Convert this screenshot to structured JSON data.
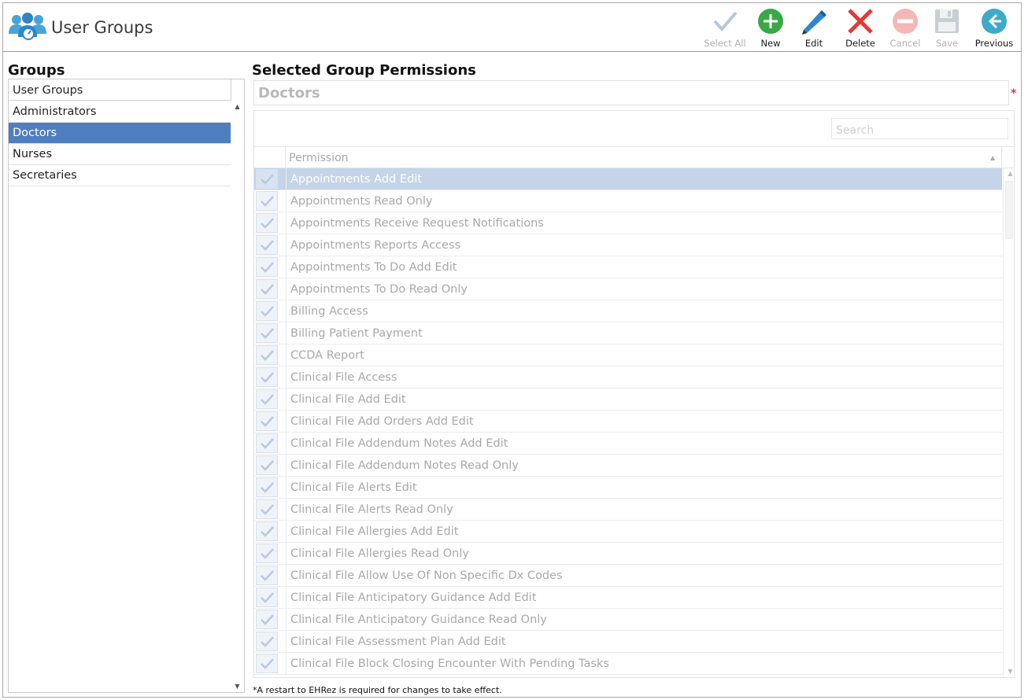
{
  "header": {
    "title": "User Groups",
    "icon": "user-groups-icon"
  },
  "toolbar": {
    "select_all": "Select All",
    "new": "New",
    "edit": "Edit",
    "delete": "Delete",
    "cancel": "Cancel",
    "save": "Save",
    "previous": "Previous"
  },
  "groups": {
    "title": "Groups",
    "column_header": "User Groups",
    "items": [
      {
        "label": "Administrators"
      },
      {
        "label": "Doctors"
      },
      {
        "label": "Nurses"
      },
      {
        "label": "Secretaries"
      }
    ],
    "selected": "Doctors"
  },
  "permissions": {
    "title": "Selected Group Permissions",
    "group_name": "Doctors",
    "required_mark": "*",
    "search_placeholder": "Search",
    "column_header": "Permission",
    "rows": [
      {
        "label": "Appointments Add Edit"
      },
      {
        "label": "Appointments Read Only"
      },
      {
        "label": "Appointments Receive Request Notifications"
      },
      {
        "label": "Appointments Reports Access"
      },
      {
        "label": "Appointments To Do Add Edit"
      },
      {
        "label": "Appointments To Do Read Only"
      },
      {
        "label": "Billing Access"
      },
      {
        "label": "Billing Patient Payment"
      },
      {
        "label": "CCDA Report"
      },
      {
        "label": "Clinical File Access"
      },
      {
        "label": "Clinical File Add Edit"
      },
      {
        "label": "Clinical File Add Orders Add Edit"
      },
      {
        "label": "Clinical File Addendum Notes Add Edit"
      },
      {
        "label": "Clinical File Addendum Notes Read Only"
      },
      {
        "label": "Clinical File Alerts Edit"
      },
      {
        "label": "Clinical File Alerts Read Only"
      },
      {
        "label": "Clinical File Allergies Add Edit"
      },
      {
        "label": "Clinical File Allergies Read Only"
      },
      {
        "label": "Clinical File Allow Use Of Non Specific Dx Codes"
      },
      {
        "label": "Clinical File Anticipatory Guidance Add Edit"
      },
      {
        "label": "Clinical File Anticipatory Guidance Read Only"
      },
      {
        "label": "Clinical File Assessment Plan Add Edit"
      },
      {
        "label": "Clinical File Block Closing Encounter With Pending Tasks"
      }
    ],
    "selected_row": "Appointments Add Edit"
  },
  "footnote": "*A restart to EHRez is required for changes to take effect.",
  "colors": {
    "selected_group": "#4f7fbf",
    "selected_row": "#c5d4e8",
    "new_green": "#3aa845",
    "delete_red": "#e53935",
    "edit_blue": "#2f87cf",
    "previous_teal": "#3fa9c8"
  }
}
